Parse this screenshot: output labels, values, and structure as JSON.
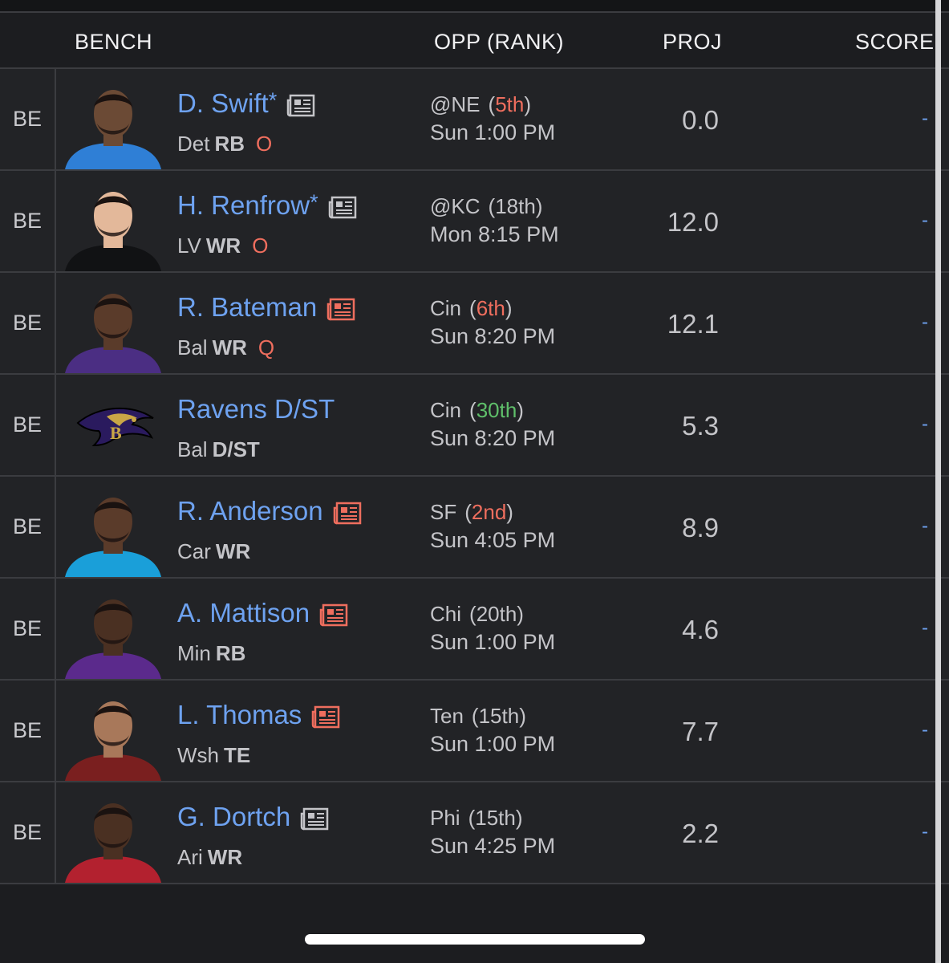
{
  "header": {
    "bench_label": "BENCH",
    "opp_label": "OPP (RANK)",
    "proj_label": "PROJ",
    "score_label": "SCORE"
  },
  "colors": {
    "name_link": "#6ea2f0",
    "injury": "#ef6e5e",
    "rank_tough": "#ef6e5e",
    "rank_easy": "#5fbf6a",
    "rank_neutral": "#c4c4c8"
  },
  "players": [
    {
      "slot": "BE",
      "name": "D. Swift",
      "star": "*",
      "has_news": true,
      "news_highlight": false,
      "team": "Det",
      "pos": "RB",
      "injury": "O",
      "opp": "@NE",
      "rank_open": "(",
      "rank": "5th",
      "rank_close": ")",
      "rank_tone": "tough",
      "time": "Sun 1:00 PM",
      "proj": "0.0",
      "score": "-",
      "jersey": "#2f7fd6",
      "skin": "#6b4a35",
      "avatar_icon": "player-headshot"
    },
    {
      "slot": "BE",
      "name": "H. Renfrow",
      "star": "*",
      "has_news": true,
      "news_highlight": false,
      "team": "LV",
      "pos": "WR",
      "injury": "O",
      "opp": "@KC",
      "rank_open": "(",
      "rank": "18th",
      "rank_close": ")",
      "rank_tone": "neutral",
      "time": "Mon 8:15 PM",
      "proj": "12.0",
      "score": "-",
      "jersey": "#111214",
      "skin": "#e3b89a",
      "avatar_icon": "player-headshot"
    },
    {
      "slot": "BE",
      "name": "R. Bateman",
      "star": "",
      "has_news": true,
      "news_highlight": true,
      "team": "Bal",
      "pos": "WR",
      "injury": "Q",
      "opp": "Cin",
      "rank_open": "(",
      "rank": "6th",
      "rank_close": ")",
      "rank_tone": "tough",
      "time": "Sun 8:20 PM",
      "proj": "12.1",
      "score": "-",
      "jersey": "#4b2e83",
      "skin": "#5a3b2a",
      "avatar_icon": "player-headshot"
    },
    {
      "slot": "BE",
      "name": "Ravens D/ST",
      "star": "",
      "has_news": false,
      "news_highlight": false,
      "team": "Bal",
      "pos": "D/ST",
      "injury": "",
      "opp": "Cin",
      "rank_open": "(",
      "rank": "30th",
      "rank_close": ")",
      "rank_tone": "easy",
      "time": "Sun 8:20 PM",
      "proj": "5.3",
      "score": "-",
      "jersey": "",
      "skin": "",
      "avatar_icon": "ravens-logo"
    },
    {
      "slot": "BE",
      "name": "R. Anderson",
      "star": "",
      "has_news": true,
      "news_highlight": true,
      "team": "Car",
      "pos": "WR",
      "injury": "",
      "opp": "SF",
      "rank_open": "(",
      "rank": "2nd",
      "rank_close": ")",
      "rank_tone": "tough",
      "time": "Sun 4:05 PM",
      "proj": "8.9",
      "score": "-",
      "jersey": "#1a9fd9",
      "skin": "#5a3b2a",
      "avatar_icon": "player-headshot"
    },
    {
      "slot": "BE",
      "name": "A. Mattison",
      "star": "",
      "has_news": true,
      "news_highlight": true,
      "team": "Min",
      "pos": "RB",
      "injury": "",
      "opp": "Chi",
      "rank_open": "(",
      "rank": "20th",
      "rank_close": ")",
      "rank_tone": "neutral",
      "time": "Sun 1:00 PM",
      "proj": "4.6",
      "score": "-",
      "jersey": "#5b2a8c",
      "skin": "#4a3022",
      "avatar_icon": "player-headshot"
    },
    {
      "slot": "BE",
      "name": "L. Thomas",
      "star": "",
      "has_news": true,
      "news_highlight": true,
      "team": "Wsh",
      "pos": "TE",
      "injury": "",
      "opp": "Ten",
      "rank_open": "(",
      "rank": "15th",
      "rank_close": ")",
      "rank_tone": "neutral",
      "time": "Sun 1:00 PM",
      "proj": "7.7",
      "score": "-",
      "jersey": "#7a1f1f",
      "skin": "#a8785a",
      "avatar_icon": "player-headshot"
    },
    {
      "slot": "BE",
      "name": "G. Dortch",
      "star": "",
      "has_news": true,
      "news_highlight": false,
      "team": "Ari",
      "pos": "WR",
      "injury": "",
      "opp": "Phi",
      "rank_open": "(",
      "rank": "15th",
      "rank_close": ")",
      "rank_tone": "neutral",
      "time": "Sun 4:25 PM",
      "proj": "2.2",
      "score": "-",
      "jersey": "#b3212f",
      "skin": "#4a3022",
      "avatar_icon": "player-headshot"
    }
  ]
}
